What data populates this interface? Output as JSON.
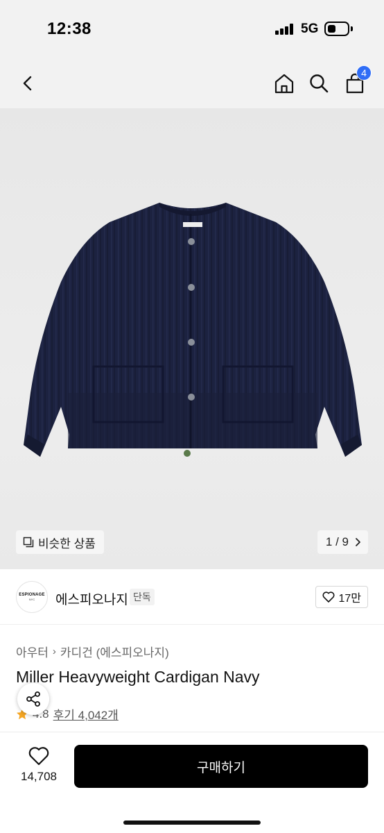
{
  "status": {
    "time": "12:38",
    "network": "5G"
  },
  "nav": {
    "back_icon": "chevron-left-icon",
    "home_icon": "home-icon",
    "search_icon": "search-icon",
    "cart_icon": "shopping-bag-icon",
    "cart_count": "4"
  },
  "gallery": {
    "similar_label": "비슷한 상품",
    "counter": "1 / 9",
    "product_color": "#1c2240"
  },
  "brand": {
    "logo_line1": "ESPIONAGE",
    "logo_line2": "NYC",
    "name": "에스피오나지",
    "tag": "단독",
    "likes": "17만"
  },
  "product": {
    "category": "아우터",
    "subcategory": "카디건 (에스피오나지)",
    "title": "Miller Heavyweight Cardigan Navy",
    "rating": "4.8",
    "reviews": "후기 4,042개"
  },
  "bottom": {
    "wish_count": "14,708",
    "buy_label": "구매하기"
  },
  "colors": {
    "accent_badge": "#2f6df6",
    "star": "#f5a623",
    "buy_button": "#000000"
  }
}
